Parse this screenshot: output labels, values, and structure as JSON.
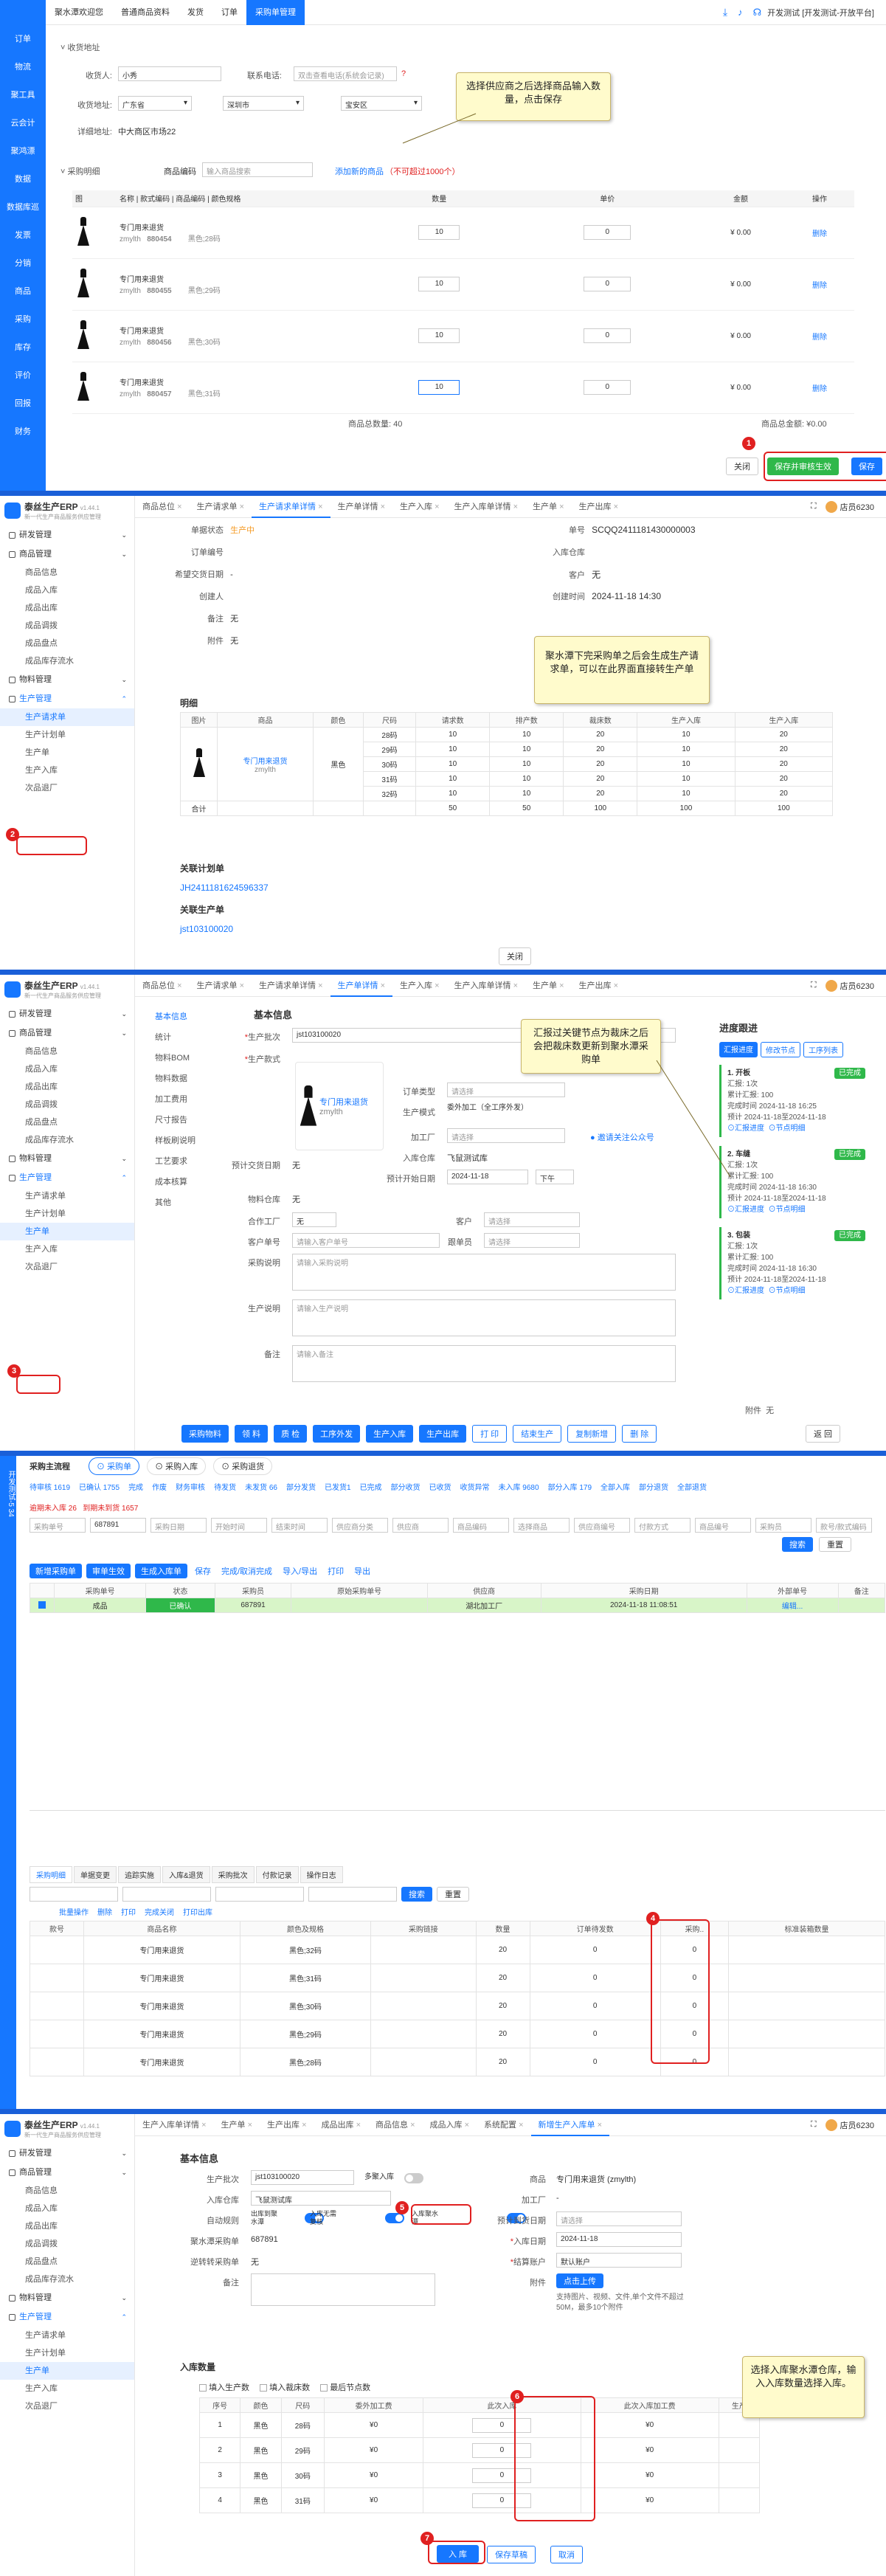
{
  "s1": {
    "top_nav": [
      "聚水潭欢迎您",
      "普通商品资料",
      "发货",
      "订单",
      "采购单管理"
    ],
    "top_right": "开发测试 [开发测试-开放平台]",
    "left_nav": [
      "订单",
      "物流",
      "聚工具",
      "云会计",
      "聚鸿漂",
      "数据",
      "数据库巡",
      "发票",
      "分销",
      "商品",
      "采购",
      "库存",
      "评价",
      "回报",
      "财务"
    ],
    "section_addr": "收货地址",
    "receiver_label": "收货人:",
    "receiver_value": "小秀",
    "phone_label": "联系电话:",
    "phone_placeholder": "双击查看电话(系统会记录)",
    "region_label": "收货地址:",
    "province": "广东省",
    "city": "深圳市",
    "district": "宝安区",
    "detail_label": "详细地址:",
    "detail_value": "中大商区市场22",
    "section_items": "采购明细",
    "code_label": "商品编码",
    "code_placeholder": "输入商品搜索",
    "add_link": "添加新的商品",
    "add_hint": "（不可超过1000个）",
    "headers": [
      "图",
      "名称 | 款式编码 | 商品编码 | 颜色规格",
      "数量",
      "单价",
      "金额",
      "操作"
    ],
    "rows": [
      {
        "name": "专门用来退货",
        "sku": "zmylth",
        "code": "880454",
        "spec": "黑色;28码",
        "qty": "10",
        "price": "0",
        "amount": "¥ 0.00",
        "op": "删除"
      },
      {
        "name": "专门用来退货",
        "sku": "zmylth",
        "code": "880455",
        "spec": "黑色;29码",
        "qty": "10",
        "price": "0",
        "amount": "¥ 0.00",
        "op": "删除"
      },
      {
        "name": "专门用来退货",
        "sku": "zmylth",
        "code": "880456",
        "spec": "黑色;30码",
        "qty": "10",
        "price": "0",
        "amount": "¥ 0.00",
        "op": "删除"
      },
      {
        "name": "专门用来退货",
        "sku": "zmylth",
        "code": "880457",
        "spec": "黑色;31码",
        "qty": "10",
        "price": "0",
        "amount": "¥ 0.00",
        "op": "删除"
      }
    ],
    "total_qty": "商品总数量: 40",
    "total_amount": "商品总金额: ¥0.00",
    "close": "关闭",
    "save_submit": "保存并审核生效",
    "save": "保存",
    "note": "选择供应商之后选择商品输入数量，点击保存",
    "badge": "1"
  },
  "app": {
    "name": "泰丝生产ERP",
    "version": "v1.44.1",
    "slogan": "新一代生产商品服务供应管理",
    "user": "店员6230"
  },
  "s2": {
    "tabs": [
      "商品总位",
      "生产请求单",
      "生产请求单详情",
      "生产单详情",
      "生产入库",
      "生产入库单详情",
      "生产单",
      "生产出库"
    ],
    "nav": [
      {
        "t": "研发管理",
        "h": 1
      },
      {
        "t": "商品管理",
        "h": 1
      },
      {
        "t": "商品信息"
      },
      {
        "t": "成品入库"
      },
      {
        "t": "成品出库"
      },
      {
        "t": "成品调拨"
      },
      {
        "t": "成品盘点"
      },
      {
        "t": "成品库存流水"
      },
      {
        "t": "物料管理",
        "h": 1
      },
      {
        "t": "生产管理",
        "h": 1,
        "a": 1
      },
      {
        "t": "生产请求单",
        "s": 1
      },
      {
        "t": "生产计划单"
      },
      {
        "t": "生产单"
      },
      {
        "t": "生产入库"
      },
      {
        "t": "次品退厂"
      }
    ],
    "fields_left": [
      [
        "单据状态",
        "生产中"
      ],
      [
        "订单编号",
        ""
      ],
      [
        "希望交货日期",
        "-"
      ],
      [
        "创建人",
        ""
      ],
      [
        "备注",
        "无"
      ],
      [
        "附件",
        "无"
      ]
    ],
    "fields_right": [
      [
        "单号",
        "SCQQ2411181430000003"
      ],
      [
        "入库仓库",
        ""
      ],
      [
        "客户",
        "无"
      ],
      [
        "创建时间",
        "2024-11-18 14:30"
      ]
    ],
    "detail_title": "明细",
    "headers": [
      "图片",
      "商品",
      "颜色",
      "尺码",
      "请求数",
      "排产数",
      "裁床数",
      "生产入库",
      "生产入库"
    ],
    "product": "专门用来退货",
    "sku": "zmylth",
    "color": "黑色",
    "rows": [
      [
        "28码",
        "10",
        "10",
        "20",
        "10",
        "20"
      ],
      [
        "29码",
        "10",
        "10",
        "20",
        "10",
        "20"
      ],
      [
        "30码",
        "10",
        "10",
        "20",
        "10",
        "20"
      ],
      [
        "31码",
        "10",
        "10",
        "20",
        "10",
        "20"
      ],
      [
        "32码",
        "10",
        "10",
        "20",
        "10",
        "20"
      ]
    ],
    "sum": [
      "合计",
      "",
      "",
      "",
      "50",
      "50",
      "100",
      "100",
      "100"
    ],
    "plan_title": "关联计划单",
    "plan_link": "JH2411181624596337",
    "prod_title": "关联生产单",
    "prod_link": "jst103100020",
    "close": "关闭",
    "note": "聚水潭下完采购单之后会生成生产请求单，可以在此界面直接转生产单",
    "badge": "2"
  },
  "s3": {
    "tabs": [
      "商品总位",
      "生产请求单",
      "生产请求单详情",
      "生产单详情",
      "生产入库",
      "生产入库单详情",
      "生产单",
      "生产出库"
    ],
    "inner_nav": [
      "基本信息",
      "统计",
      "物料BOM",
      "物料数据",
      "加工费用",
      "尺寸报告",
      "样板刷说明",
      "工艺要求",
      "成本核算",
      "其他"
    ],
    "title": "基本信息",
    "batch_label": "生产批次",
    "batch": "jst103100020",
    "style_label": "生产款式",
    "product": "专门用来退货",
    "sku": "zmylth",
    "order_type_label": "订单类型",
    "order_type": "请选择",
    "mode_label": "生产模式",
    "mode": "委外加工（全工序外发）",
    "factory_label": "加工厂",
    "factory": "请选择",
    "factory_link": "邀请关注公众号",
    "stock_label": "入库仓库",
    "stock": "飞鼠测试库",
    "start_label": "预计开始日期",
    "start": "2024-11-18",
    "noon": "下午",
    "delivery_label": "预计交货日期",
    "delivery": "无",
    "mat_label": "物料仓库",
    "mat": "无",
    "partner_label": "合作工厂",
    "partner": "无",
    "cust_label": "客户",
    "cust": "请选择",
    "custno_label": "客户单号",
    "custno": "请输入客户单号",
    "tracker_label": "跟单员",
    "tracker": "请选择",
    "purch_label": "采购说明",
    "purch": "请输入采购说明",
    "prod_label": "生产说明",
    "prod": "请输入生产说明",
    "remark_label": "备注",
    "remark": "请输入备注",
    "attach_label": "附件",
    "attach": "无",
    "buttons": [
      "采购物料",
      "领 料",
      "质 检",
      "工序外发",
      "生产入库",
      "生产出库",
      "打 印",
      "结束生产",
      "复制新增",
      "删 除"
    ],
    "back": "返 回",
    "progress_title": "进度跟进",
    "progress_tabs": [
      "汇报进度",
      "修改节点",
      "工序列表"
    ],
    "steps": [
      {
        "name": "1. 开板",
        "state": "已完成",
        "count": "汇报: 1次",
        "total": "累计汇报: 100",
        "last": "完成时间 2024-11-18 16:25",
        "plan": "预计 2024-11-18至2024-11-18",
        "a1": "汇报进度",
        "a2": "节点明细"
      },
      {
        "name": "2. 车缝",
        "state": "已完成",
        "count": "汇报: 1次",
        "total": "累计汇报: 100",
        "last": "完成时间 2024-11-18 16:30",
        "plan": "预计 2024-11-18至2024-11-18",
        "a1": "汇报进度",
        "a2": "节点明细"
      },
      {
        "name": "3. 包装",
        "state": "已完成",
        "count": "汇报: 1次",
        "total": "累计汇报: 100",
        "last": "完成时间 2024-11-18 16:30",
        "plan": "预计 2024-11-18至2024-11-18",
        "a1": "汇报进度",
        "a2": "节点明细"
      }
    ],
    "note": "汇报过关键节点为裁床之后会把裁床数更新到聚水潭采购单",
    "badge": "3"
  },
  "s4": {
    "left_strip": "开发测试-5 34",
    "top_tabs": [
      "采购单",
      "采购入库",
      "采购退货"
    ],
    "filter_title": "采购主流程",
    "stats": [
      "待审核 1619",
      "已确认 1755",
      "完成",
      "作废",
      "财务审核",
      "待发货",
      "未发货 66",
      "部分发货",
      "已发货1",
      "已完成",
      "部分收货",
      "已收货",
      "收货异常",
      "未入库 9680",
      "部分入库 179",
      "全部入库",
      "部分退货",
      "全部退货"
    ],
    "overdue": "逾期未入库 26",
    "due": "到期未到货 1657",
    "form": [
      "采购单号",
      "687891",
      "采购日期",
      "开始时间",
      "结束时间",
      "供应商分类",
      "供应商",
      "商品编码",
      "选择商品",
      "供应商编号",
      "付款方式",
      "商品编号",
      "采购员",
      "款号/款式编码"
    ],
    "search": "搜索",
    "reset": "重置",
    "toolbar": [
      "新增采购单",
      "审单生效",
      "生成入库单",
      "保存",
      "完成/取消完成",
      "导入/导出",
      "打印",
      "导出"
    ],
    "grid_headers": [
      "",
      "采购单号",
      "状态",
      "采购员",
      "原始采购单号",
      "供应商",
      "采购日期",
      "外部单号",
      "备注"
    ],
    "grid_row": {
      "id": "成品",
      "status": "已确认",
      "po": "687891",
      "sup": "湖北加工厂",
      "date": "2024-11-18 11:08:51",
      "link": "编辑..."
    },
    "bottom_tabs": [
      "采购明细",
      "单据变更",
      "追踪实施",
      "入库&退货",
      "采购批次",
      "付款记录",
      "操作日志"
    ],
    "bottom_search": "搜索",
    "bottom_reset": "重置",
    "bottom_toolbar": [
      "批量操作",
      "删除",
      "打印",
      "完成关闭",
      "打印出库"
    ],
    "bottom_headers": [
      "款号",
      "商品名称",
      "颜色及规格",
      "采购链接",
      "数量",
      "订单待发数",
      "采购..",
      "标准装箱数量"
    ],
    "rows": [
      [
        "专门用来退货",
        "黑色;32码",
        "20",
        "0",
        "0"
      ],
      [
        "专门用来退货",
        "黑色;31码",
        "20",
        "0",
        "0"
      ],
      [
        "专门用来退货",
        "黑色;30码",
        "20",
        "0",
        "0"
      ],
      [
        "专门用来退货",
        "黑色;29码",
        "20",
        "0",
        "0"
      ],
      [
        "专门用来退货",
        "黑色;28码",
        "20",
        "0",
        "0"
      ]
    ],
    "badge": "4"
  },
  "s5": {
    "tabs": [
      "生产入库单详情",
      "生产单",
      "生产出库",
      "成品出库",
      "商品信息",
      "成品入库",
      "系统配置",
      "新增生产入库单"
    ],
    "nav": [
      {
        "t": "研发管理",
        "h": 1
      },
      {
        "t": "商品管理",
        "h": 1
      },
      {
        "t": "商品信息"
      },
      {
        "t": "成品入库"
      },
      {
        "t": "成品出库"
      },
      {
        "t": "成品调拨"
      },
      {
        "t": "成品盘点"
      },
      {
        "t": "成品库存流水"
      },
      {
        "t": "物料管理",
        "h": 1
      },
      {
        "t": "生产管理",
        "h": 1,
        "a": 1
      },
      {
        "t": "生产请求单"
      },
      {
        "t": "生产计划单"
      },
      {
        "t": "生产单",
        "s": 1
      },
      {
        "t": "生产入库"
      },
      {
        "t": "次品退厂"
      }
    ],
    "title": "基本信息",
    "batch_label": "生产批次",
    "batch": "jst103100020",
    "multi_label": "多聚入库",
    "goods_label": "商品",
    "goods": "专门用来退货 (zmylth)",
    "stock_label": "入库仓库",
    "stock": "飞鼠测试库",
    "factory_label": "加工厂",
    "factory": "-",
    "rule_label": "自动规则",
    "rule1": "出库到聚水潭",
    "rule2": "入库无需复核",
    "rule3": "入库聚水潭",
    "pay_date_label": "预计到货日期",
    "pay_date": "请选择",
    "po_label": "聚水潭采购单",
    "po": "687891",
    "in_date_label": "入库日期",
    "in_date": "2024-11-18",
    "reverse_label": "逆转转采购单",
    "reverse": "无",
    "account_label": "结算账户",
    "account": "默认账户",
    "remark_label": "备注",
    "attach_label": "附件",
    "upload": "点击上传",
    "upload_hint": "支持图片、视频、文件,单个文件不超过50M，最多10个附件",
    "detail_title": "入库数量",
    "opts": [
      "填入生产数",
      "填入裁床数",
      "最后节点数"
    ],
    "headers": [
      "序号",
      "颜色",
      "尺码",
      "委外加工费",
      "此次入库",
      "此次入库加工费",
      "生产"
    ],
    "rows": [
      [
        "1",
        "黑色",
        "28码",
        "¥0",
        "0",
        "¥0"
      ],
      [
        "2",
        "黑色",
        "29码",
        "¥0",
        "0",
        "¥0"
      ],
      [
        "3",
        "黑色",
        "30码",
        "¥0",
        "0",
        "¥0"
      ],
      [
        "4",
        "黑色",
        "31码",
        "¥0",
        "0",
        "¥0"
      ]
    ],
    "submit": "入 库",
    "save_draft": "保存草稿",
    "cancel": "取消",
    "note": "选择入库聚水潭仓库，输入入库数量选择入库。",
    "badges": [
      "5",
      "6",
      "7"
    ]
  }
}
